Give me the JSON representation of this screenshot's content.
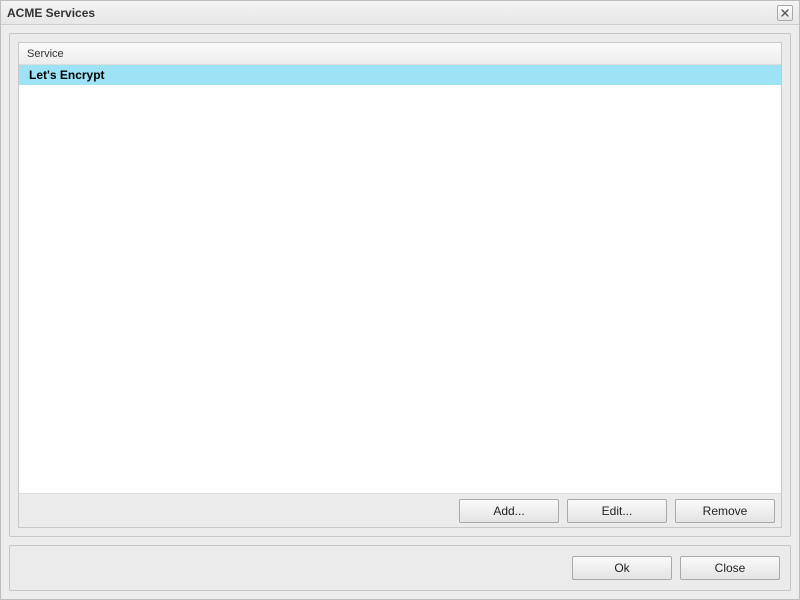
{
  "window": {
    "title": "ACME Services"
  },
  "list": {
    "header": "Service",
    "items": [
      {
        "label": "Let's Encrypt",
        "selected": true
      }
    ]
  },
  "buttons": {
    "add": "Add...",
    "edit": "Edit...",
    "remove": "Remove",
    "ok": "Ok",
    "close": "Close"
  }
}
